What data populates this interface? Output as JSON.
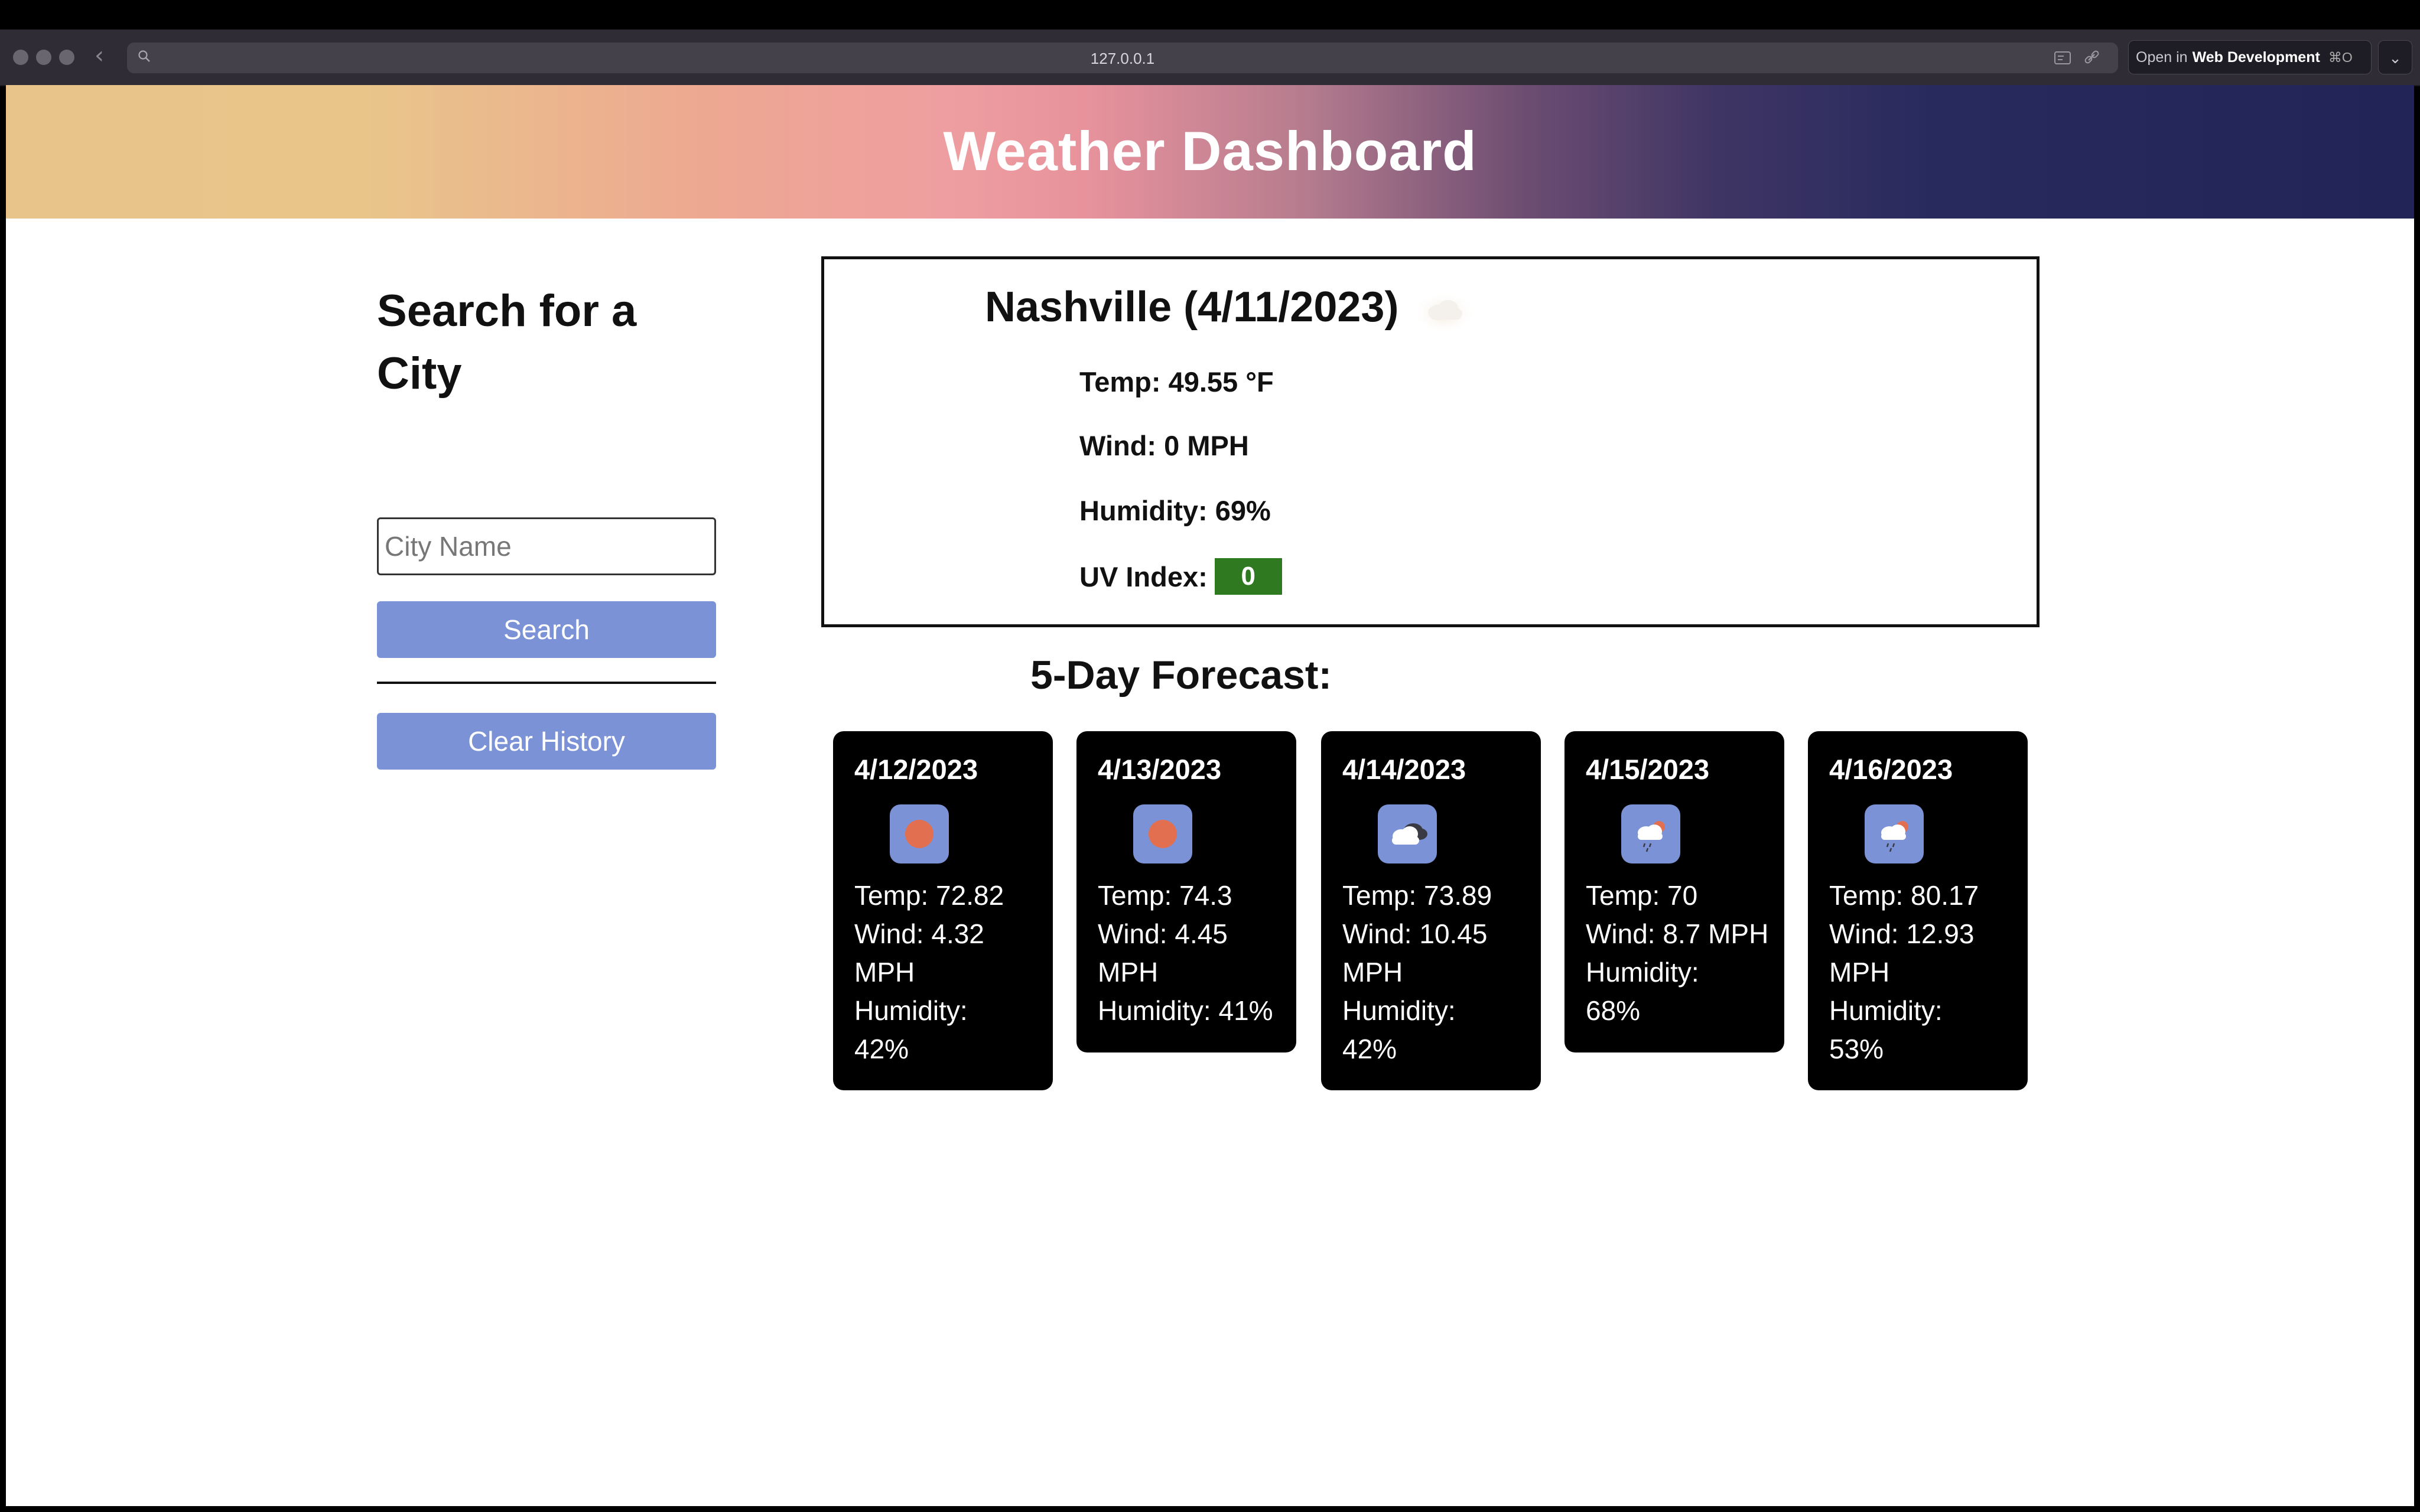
{
  "browser": {
    "url": "127.0.0.1",
    "open_in_prefix": "Open in",
    "open_in_target": "Web Development",
    "open_in_shortcut": "⌘O"
  },
  "header": {
    "title": "Weather Dashboard"
  },
  "search": {
    "heading": "Search for a City",
    "input_placeholder": "City Name",
    "input_value": "",
    "search_label": "Search",
    "clear_label": "Clear History"
  },
  "current": {
    "title": "Nashville (4/11/2023)",
    "icon": "cloud-icon",
    "temp": "Temp: 49.55 °F",
    "wind": "Wind: 0 MPH",
    "humidity": "Humidity: 69%",
    "uv_label": "UV Index:",
    "uv_value": "0",
    "uv_color": "#2f7a20"
  },
  "forecast": {
    "heading": "5-Day Forecast:",
    "days": [
      {
        "date": "4/12/2023",
        "icon": "sun-icon",
        "lines": [
          "Temp: 72.82",
          "Wind: 4.32",
          "MPH",
          "Humidity:",
          "42%"
        ]
      },
      {
        "date": "4/13/2023",
        "icon": "sun-icon",
        "lines": [
          "Temp: 74.3",
          "Wind: 4.45",
          "MPH",
          "Humidity: 41%"
        ]
      },
      {
        "date": "4/14/2023",
        "icon": "clouds-icon",
        "lines": [
          "Temp: 73.89",
          "Wind: 10.45",
          "MPH",
          "Humidity:",
          "42%"
        ]
      },
      {
        "date": "4/15/2023",
        "icon": "rain-cloud-icon",
        "lines": [
          "Temp: 70",
          "Wind: 8.7 MPH",
          "Humidity:",
          "68%"
        ]
      },
      {
        "date": "4/16/2023",
        "icon": "rain-cloud-icon",
        "lines": [
          "Temp: 80.17",
          "Wind: 12.93",
          "MPH",
          "Humidity:",
          "53%"
        ]
      }
    ]
  },
  "colors": {
    "button": "#7b93d6",
    "card": "#000000",
    "icon_bg": "#7b93d6",
    "sun": "#e27050"
  }
}
